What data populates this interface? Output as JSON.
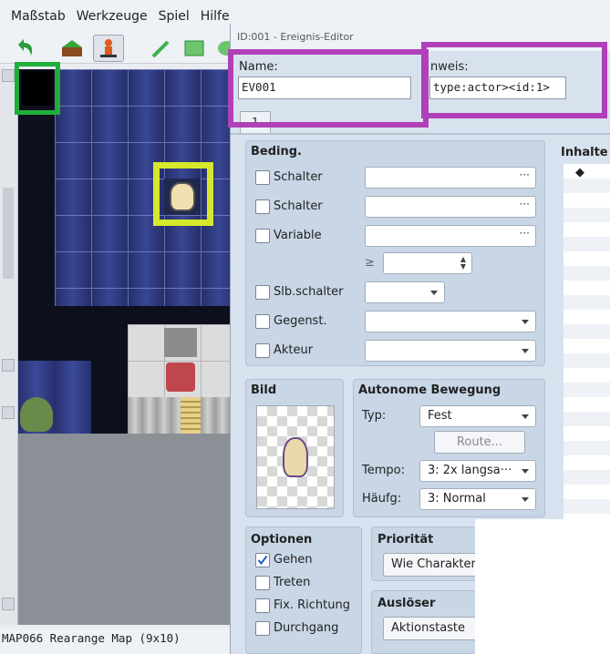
{
  "menu": [
    "Maßstab",
    "Werkzeuge",
    "Spiel",
    "Hilfe"
  ],
  "status_text": "MAP066 Rearange Map (9x10)",
  "dialog": {
    "title": "ID:001 - Ereignis-Editor",
    "name_label": "Name:",
    "name_value": "EV001",
    "note_label": "nweis:",
    "note_value": "type:actor><id:1>",
    "tab_label": "1",
    "conditions": {
      "header": "Beding.",
      "items": [
        "Schalter",
        "Schalter",
        "Variable",
        "Slb.schalter",
        "Gegenst.",
        "Akteur"
      ],
      "ge_symbol": "≥",
      "dots": "···"
    },
    "image": {
      "header": "Bild"
    },
    "autonomous": {
      "header": "Autonome Bewegung",
      "type_label": "Typ:",
      "type_value": "Fest",
      "route_button": "Route...",
      "speed_label": "Tempo:",
      "speed_value": "3: 2x langsa···",
      "freq_label": "Häufg:",
      "freq_value": "3: Normal"
    },
    "options": {
      "header": "Optionen",
      "items": [
        {
          "label": "Gehen",
          "checked": true
        },
        {
          "label": "Treten",
          "checked": false
        },
        {
          "label": "Fix. Richtung",
          "checked": false
        },
        {
          "label": "Durchgang",
          "checked": false
        }
      ]
    },
    "priority": {
      "header": "Priorität",
      "value": "Wie Charaktere"
    },
    "trigger": {
      "header": "Auslöser",
      "value": "Aktionstaste"
    },
    "contents": {
      "header": "Inhalte",
      "first_item": "◆"
    }
  },
  "colors": {
    "highlight_green": "#1fae3a",
    "highlight_purple": "#b040b8",
    "highlight_yellow": "#d6e82a"
  }
}
